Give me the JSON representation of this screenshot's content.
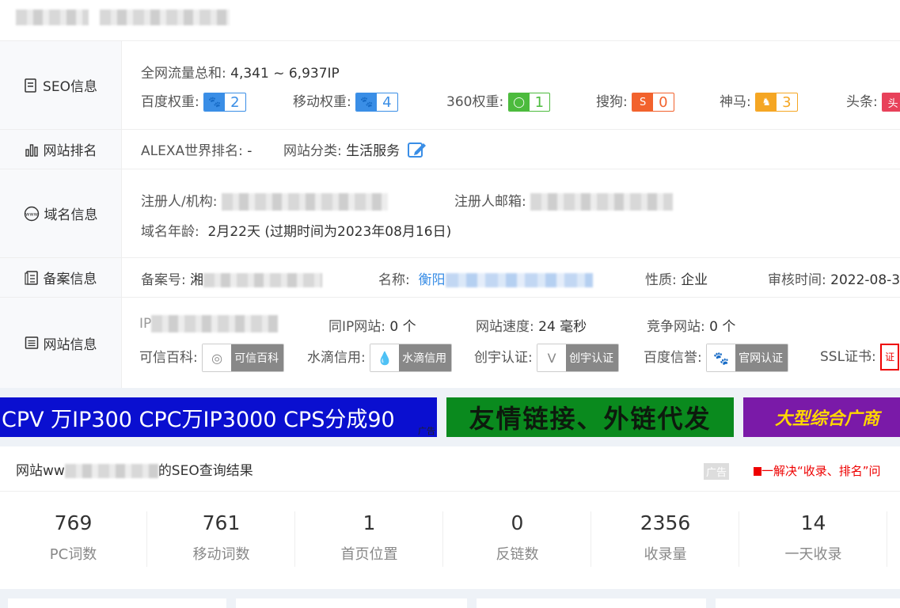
{
  "seo": {
    "label": "SEO信息",
    "traffic_label": "全网流量总和:",
    "traffic_value": "4,341 ~ 6,937IP",
    "weights": [
      {
        "label": "百度权重:",
        "value": "2",
        "color": "#3a8ee6",
        "icon": "paw-icon",
        "glyph": "🐾"
      },
      {
        "label": "移动权重:",
        "value": "4",
        "color": "#3a8ee6",
        "icon": "paw-icon",
        "glyph": "🐾"
      },
      {
        "label": "360权重:",
        "value": "1",
        "color": "#4cbb3d",
        "icon": "360-icon",
        "glyph": "◯"
      },
      {
        "label": "搜狗:",
        "value": "0",
        "color": "#f2622d",
        "icon": "sogou-icon",
        "glyph": "S"
      },
      {
        "label": "神马:",
        "value": "3",
        "color": "#f5a623",
        "icon": "shenma-icon",
        "glyph": "♞"
      },
      {
        "label": "头条:",
        "value": "",
        "color": "#e8415a",
        "icon": "toutiao-icon",
        "glyph": "头"
      }
    ]
  },
  "rank": {
    "label": "网站排名",
    "alexa_label": "ALEXA世界排名:",
    "alexa_value": "-",
    "category_label": "网站分类:",
    "category_value": "生活服务"
  },
  "domain": {
    "label": "域名信息",
    "registrant_label": "注册人/机构:",
    "email_label": "注册人邮箱:",
    "age_label": "域名年龄:",
    "age_value": "2月22天",
    "expire_text": "(过期时间为2023年08月16日)"
  },
  "icp": {
    "label": "备案信息",
    "number_label": "备案号:",
    "number_prefix": "湘",
    "name_label": "名称:",
    "name_prefix": "衡阳",
    "nature_label": "性质:",
    "nature_value": "企业",
    "review_label": "审核时间:",
    "review_value": "2022-08-3"
  },
  "site": {
    "label": "网站信息",
    "ip_label": "IP",
    "same_ip_label": "同IP网站:",
    "same_ip_value": "0 个",
    "speed_label": "网站速度:",
    "speed_value": "24 毫秒",
    "competitor_label": "竞争网站:",
    "competitor_value": "0 个",
    "badges": [
      {
        "label": "可信百科:",
        "text": "可信百科",
        "icon": "trust-icon",
        "glyph": "◎"
      },
      {
        "label": "水滴信用:",
        "text": "水滴信用",
        "icon": "water-drop-icon",
        "glyph": "💧"
      },
      {
        "label": "创宇认证:",
        "text": "创宇认证",
        "icon": "chuangyu-icon",
        "glyph": "V"
      },
      {
        "label": "百度信誉:",
        "text": "官网认证",
        "icon": "baidu-paw-icon",
        "glyph": "🐾"
      },
      {
        "label": "SSL证书:",
        "text": "",
        "icon": "ssl-icon",
        "glyph": "证"
      }
    ]
  },
  "ads": {
    "ad1": "CPV 万IP300 CPC万IP3000 CPS分成90",
    "ad1_tag": "广告",
    "ad2": "友情链接、外链代发",
    "ad3": "大型综合广商"
  },
  "result": {
    "title_prefix": "网站ww",
    "title_suffix": "的SEO查询结果",
    "ad_tag": "广告",
    "promo": "一解决“收录、排名”问",
    "stats": [
      {
        "value": "769",
        "label": "PC词数"
      },
      {
        "value": "761",
        "label": "移动词数"
      },
      {
        "value": "1",
        "label": "首页位置"
      },
      {
        "value": "0",
        "label": "反链数"
      },
      {
        "value": "2356",
        "label": "收录量"
      },
      {
        "value": "14",
        "label": "一天收录"
      }
    ]
  }
}
